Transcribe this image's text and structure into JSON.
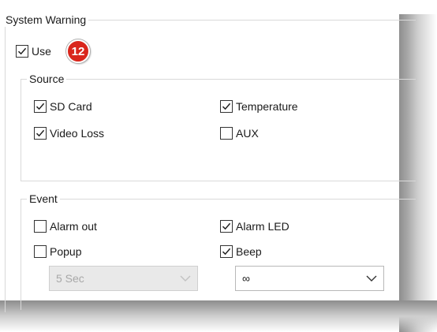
{
  "system_warning": {
    "title": "System Warning",
    "use": {
      "label": "Use",
      "checked": true
    },
    "badge": "12"
  },
  "source": {
    "title": "Source",
    "items": [
      {
        "label": "SD Card",
        "checked": true
      },
      {
        "label": "Temperature",
        "checked": true
      },
      {
        "label": "Video Loss",
        "checked": true
      },
      {
        "label": "AUX",
        "checked": false
      }
    ]
  },
  "event": {
    "title": "Event",
    "items": [
      {
        "label": "Alarm out",
        "checked": false
      },
      {
        "label": "Alarm LED",
        "checked": true
      },
      {
        "label": "Popup",
        "checked": false
      },
      {
        "label": "Beep",
        "checked": true
      }
    ],
    "popup_duration": "5 Sec",
    "beep_duration": "∞"
  },
  "colors": {
    "badge": "#d9261c",
    "border": "#d9d9d9",
    "disabled_bg": "#e9e9e9"
  }
}
